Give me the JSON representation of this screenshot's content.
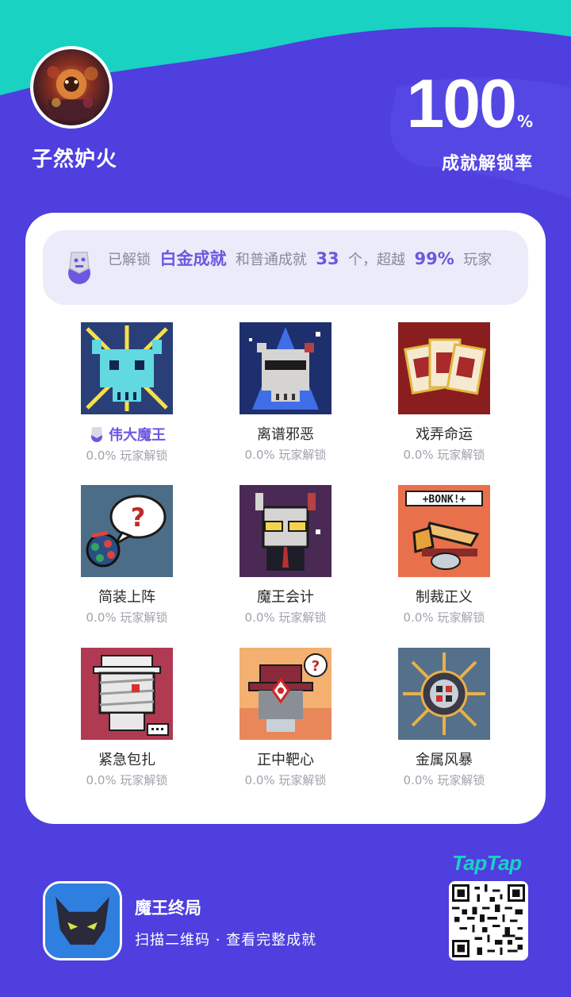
{
  "profile": {
    "username": "子然妒火"
  },
  "stats": {
    "rate_value": "100",
    "rate_unit": "%",
    "rate_label": "成就解锁率"
  },
  "banner": {
    "prefix": "已解锁",
    "platinum": "白金成就",
    "middle": "和普通成就",
    "count": "33",
    "count_unit": "个，超越",
    "percent": "99%",
    "suffix": "玩家"
  },
  "achievements": [
    {
      "name": "伟大魔王",
      "unlock": "0.0% 玩家解锁",
      "special": true,
      "icon": "demon-king-skull-icon"
    },
    {
      "name": "离谱邪恶",
      "unlock": "0.0% 玩家解锁",
      "icon": "sunglasses-skull-icon"
    },
    {
      "name": "戏弄命运",
      "unlock": "0.0% 玩家解锁",
      "icon": "cards-icon"
    },
    {
      "name": "简装上阵",
      "unlock": "0.0% 玩家解锁",
      "icon": "question-bubble-icon"
    },
    {
      "name": "魔王会计",
      "unlock": "0.0% 玩家解锁",
      "icon": "accountant-demon-icon"
    },
    {
      "name": "制裁正义",
      "unlock": "0.0% 玩家解锁",
      "icon": "bonk-hammer-icon"
    },
    {
      "name": "紧急包扎",
      "unlock": "0.0% 玩家解锁",
      "icon": "mummy-icon"
    },
    {
      "name": "正中靶心",
      "unlock": "0.0% 玩家解锁",
      "icon": "bullseye-hat-icon"
    },
    {
      "name": "金属风暴",
      "unlock": "0.0% 玩家解锁",
      "icon": "metal-storm-icon"
    }
  ],
  "footer": {
    "game_name": "魔王终局",
    "scan_text": "扫描二维码 · 查看完整成就",
    "brand": "TapTap"
  },
  "colors": {
    "background": "#4e3fde",
    "accent_teal": "#19d2c2",
    "highlight": "#6a58e0",
    "card": "#ffffff",
    "banner_bg": "#ecebf9"
  }
}
